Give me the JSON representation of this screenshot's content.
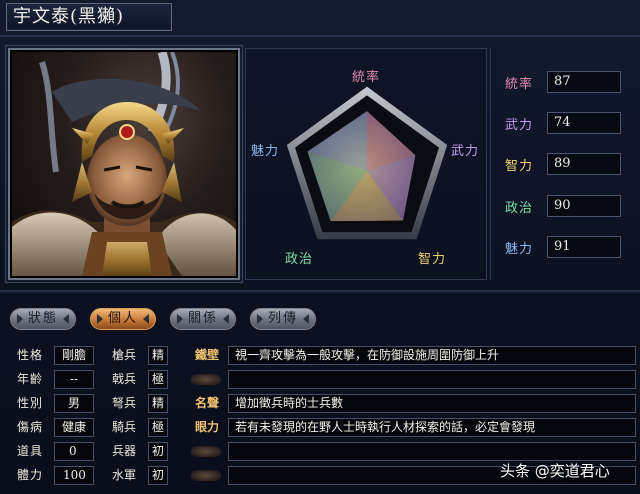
{
  "window": {
    "title": "宇文泰(黑獺)"
  },
  "radar": {
    "labels": {
      "leadership": "統率",
      "martial": "武力",
      "intelligence": "智力",
      "politics": "政治",
      "charm": "魅力"
    },
    "values": {
      "leadership": 87,
      "martial": 74,
      "intelligence": 89,
      "politics": 90,
      "charm": 91
    },
    "max": 100
  },
  "stats": [
    {
      "label": "統率",
      "value": "87",
      "color": "#e58ab0"
    },
    {
      "label": "武力",
      "value": "74",
      "color": "#c79af0"
    },
    {
      "label": "智力",
      "value": "89",
      "color": "#f0d070"
    },
    {
      "label": "政治",
      "value": "90",
      "color": "#7fe0a8"
    },
    {
      "label": "魅力",
      "value": "91",
      "color": "#8ab8f0"
    }
  ],
  "tabs": [
    {
      "label": "狀態",
      "active": false
    },
    {
      "label": "個人",
      "active": true
    },
    {
      "label": "關係",
      "active": false
    },
    {
      "label": "列傳",
      "active": false
    }
  ],
  "attributes": [
    {
      "label": "性格",
      "value": "剛膽"
    },
    {
      "label": "年齡",
      "value": "--"
    },
    {
      "label": "性別",
      "value": "男"
    },
    {
      "label": "傷病",
      "value": "健康"
    },
    {
      "label": "道具",
      "value": "0"
    },
    {
      "label": "體力",
      "value": "100"
    }
  ],
  "skills": [
    {
      "label": "槍兵",
      "rank": "精"
    },
    {
      "label": "戟兵",
      "rank": "極"
    },
    {
      "label": "弩兵",
      "rank": "精"
    },
    {
      "label": "騎兵",
      "rank": "極"
    },
    {
      "label": "兵器",
      "rank": "初"
    },
    {
      "label": "水軍",
      "rank": "初"
    }
  ],
  "traits": [
    {
      "tag": "鐵壁",
      "desc": "視一齊攻擊為一般攻擊，在防御設施周圍防御上升"
    },
    {
      "tag": "",
      "desc": ""
    },
    {
      "tag": "名聲",
      "desc": "增加徵兵時的士兵數"
    },
    {
      "tag": "眼力",
      "desc": "若有未發現的在野人士時執行人材探索的話，必定會發現"
    },
    {
      "tag": "",
      "desc": ""
    },
    {
      "tag": "",
      "desc": ""
    }
  ],
  "watermark": "头条 @奕道君心"
}
